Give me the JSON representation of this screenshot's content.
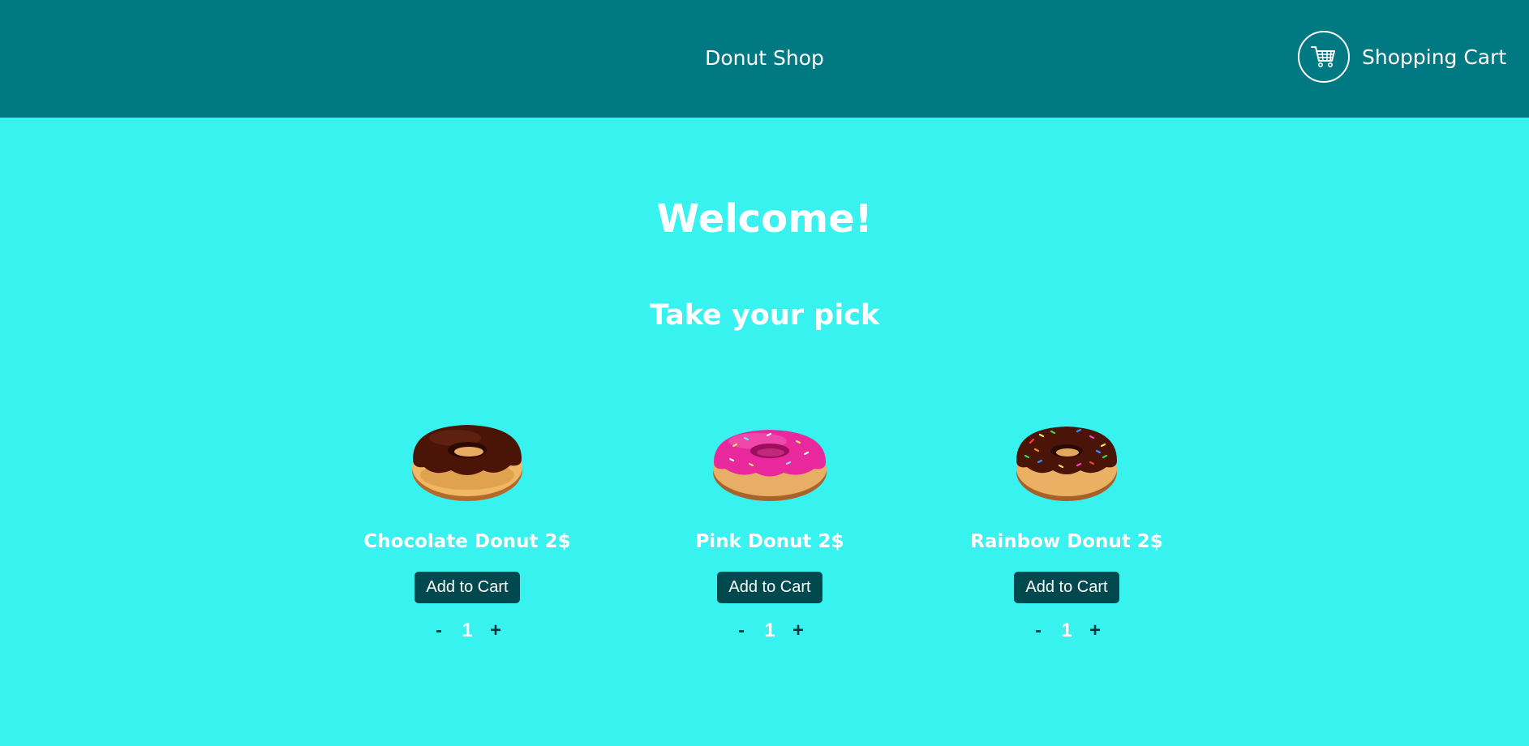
{
  "header": {
    "title": "Donut Shop",
    "cart_label": "Shopping Cart",
    "cart_icon": "shopping-cart-icon"
  },
  "main": {
    "heading": "Welcome!",
    "subheading": "Take your pick"
  },
  "products": [
    {
      "name": "Chocolate Donut 2$",
      "button": "Add to Cart",
      "decrement": "-",
      "quantity": "1",
      "increment": "+",
      "icon": "chocolate-donut-image"
    },
    {
      "name": "Pink Donut 2$",
      "button": "Add to Cart",
      "decrement": "-",
      "quantity": "1",
      "increment": "+",
      "icon": "pink-donut-image"
    },
    {
      "name": "Rainbow Donut 2$",
      "button": "Add to Cart",
      "decrement": "-",
      "quantity": "1",
      "increment": "+",
      "icon": "rainbow-donut-image"
    }
  ],
  "colors": {
    "header_bg": "#007983",
    "page_bg": "#38f2f0",
    "button_bg": "#004a4f",
    "text": "#ffffff"
  }
}
